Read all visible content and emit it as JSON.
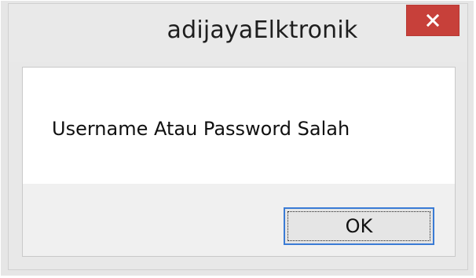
{
  "dialog": {
    "title": "adijayaElktronik",
    "message": "Username Atau Password Salah",
    "ok_label": "OK"
  },
  "titlebar": {
    "close_icon": "close-icon",
    "close_color": "#c7403a"
  }
}
